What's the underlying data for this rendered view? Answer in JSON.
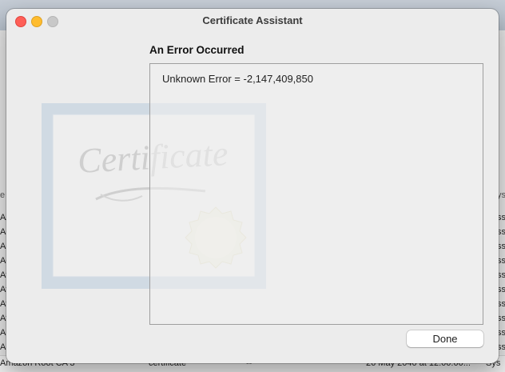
{
  "background_window": {
    "rows": [
      {
        "c1": "AA",
        "c2": "ssi"
      },
      {
        "c1": "AC",
        "c2": "ssi"
      },
      {
        "c1": "AC",
        "c2": "ssi"
      },
      {
        "c1": "Ac",
        "c2": "ssi"
      },
      {
        "c1": "Aff",
        "c2": "ssi"
      },
      {
        "c1": "Aff",
        "c2": "ssi"
      },
      {
        "c1": "Aff",
        "c2": "ssi"
      },
      {
        "c1": "Aff",
        "c2": "ssi"
      },
      {
        "c1": "Am",
        "c2": "ssi"
      },
      {
        "c1": "Am",
        "c2": "ssi"
      }
    ],
    "header_left": "e",
    "header_right": "ys",
    "last_row": {
      "name": "Amazon Root CA 3",
      "kind": "certificate",
      "dash": "--",
      "date": "26 May 2040 at 12:00:00...",
      "keychain": "Sys"
    }
  },
  "window": {
    "title": "Certificate Assistant"
  },
  "main": {
    "heading": "An Error Occurred",
    "error_message": "Unknown Error = -2,147,409,850",
    "done_label": "Done"
  },
  "illustration": {
    "certificate_word": "Certificate"
  }
}
